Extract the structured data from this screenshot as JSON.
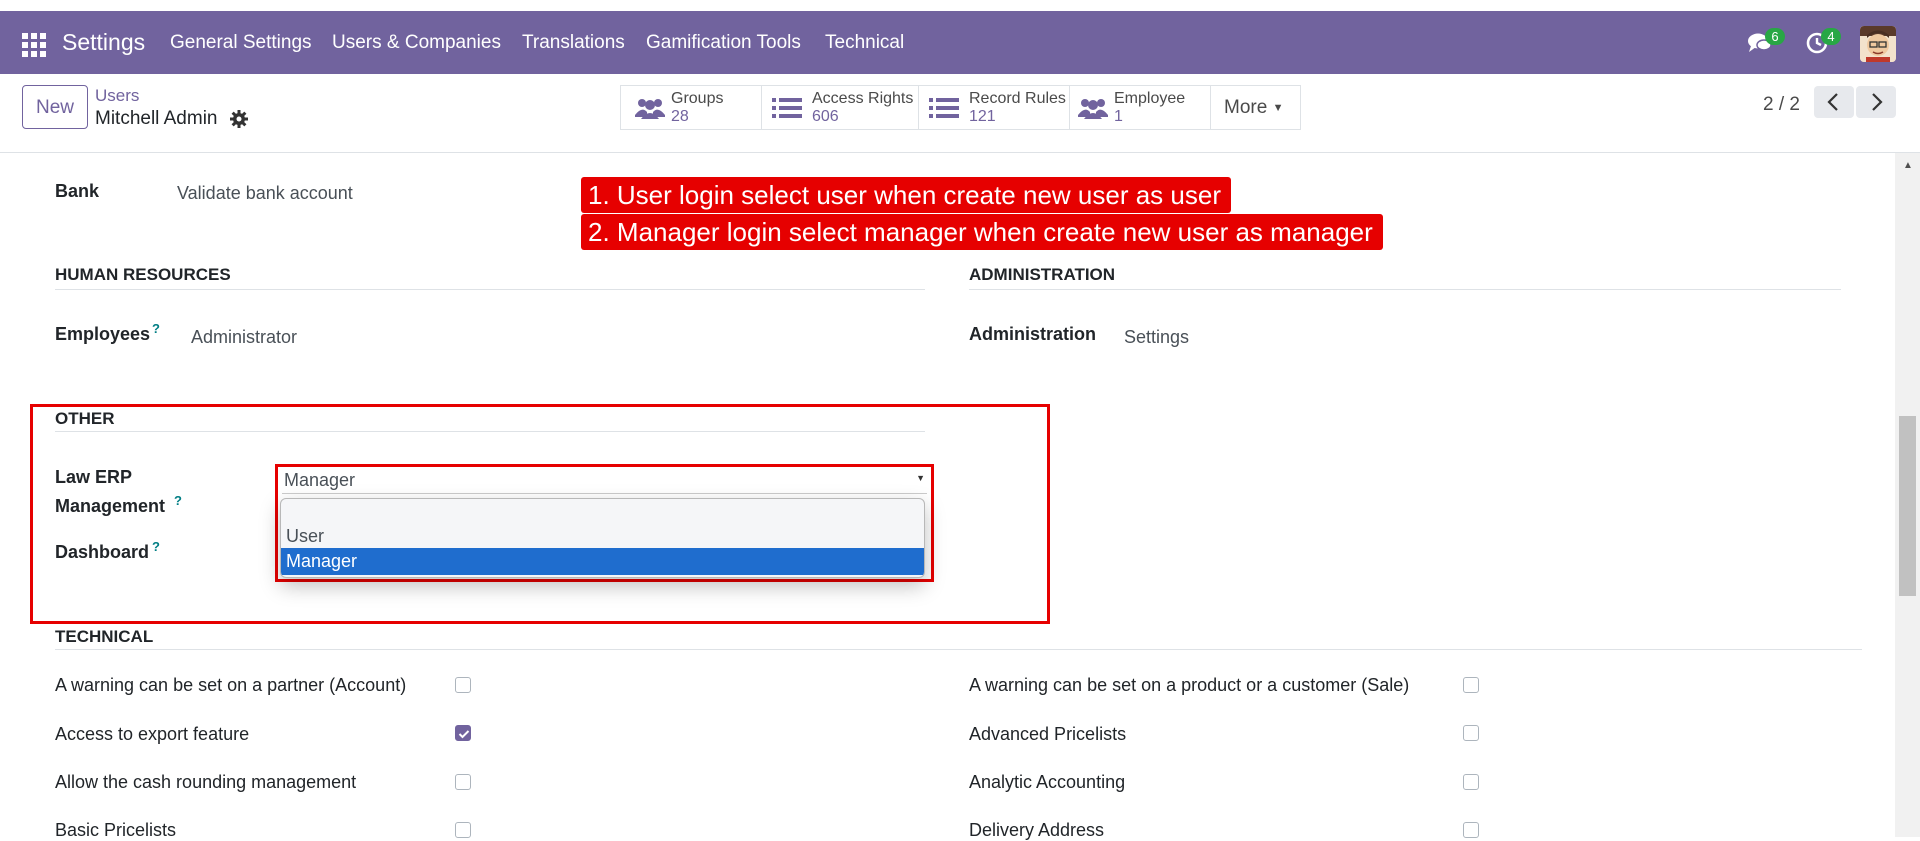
{
  "navbar": {
    "title": "Settings",
    "menu": [
      "General Settings",
      "Users & Companies",
      "Translations",
      "Gamification Tools",
      "Technical"
    ],
    "messages_count": "6",
    "activities_count": "4"
  },
  "control_panel": {
    "new_label": "New",
    "breadcrumb_parent": "Users",
    "breadcrumb_current": "Mitchell Admin",
    "smart_buttons": [
      {
        "label": "Groups",
        "value": "28"
      },
      {
        "label": "Access Rights",
        "value": "606"
      },
      {
        "label": "Record Rules",
        "value": "121"
      },
      {
        "label": "Employee",
        "value": "1"
      }
    ],
    "more_label": "More",
    "pager": "2 / 2"
  },
  "annotations": {
    "line1": "1. User login select user when create new user as user",
    "line2": "2. Manager login select manager when create new user as manager"
  },
  "form": {
    "bank_label": "Bank",
    "bank_value": "Validate bank account",
    "hr_section": "HUMAN RESOURCES",
    "employees_label": "Employees",
    "employees_value": "Administrator",
    "admin_section": "ADMINISTRATION",
    "administration_label": "Administration",
    "administration_value": "Settings",
    "other_section": "OTHER",
    "law_label_1": "Law ERP",
    "law_label_2": "Management",
    "law_value": "Manager",
    "dashboard_label": "Dashboard",
    "dropdown_options": [
      "",
      "User",
      "Manager"
    ],
    "dropdown_selected": "Manager",
    "help_mark": "?",
    "technical_section": "TECHNICAL",
    "technical_left": [
      {
        "label": "A warning can be set on a partner (Account)",
        "checked": false
      },
      {
        "label": "Access to export feature",
        "checked": true
      },
      {
        "label": "Allow the cash rounding management",
        "checked": false
      },
      {
        "label": "Basic Pricelists",
        "checked": false
      }
    ],
    "technical_right": [
      {
        "label": "A warning can be set on a product or a customer (Sale)",
        "checked": false
      },
      {
        "label": "Advanced Pricelists",
        "checked": false
      },
      {
        "label": "Analytic Accounting",
        "checked": false
      },
      {
        "label": "Delivery Address",
        "checked": false
      }
    ]
  },
  "colors": {
    "brand": "#71639e",
    "annotation_red": "#e60000",
    "selected_option": "#1f6dce",
    "badge_green": "#28a745"
  }
}
